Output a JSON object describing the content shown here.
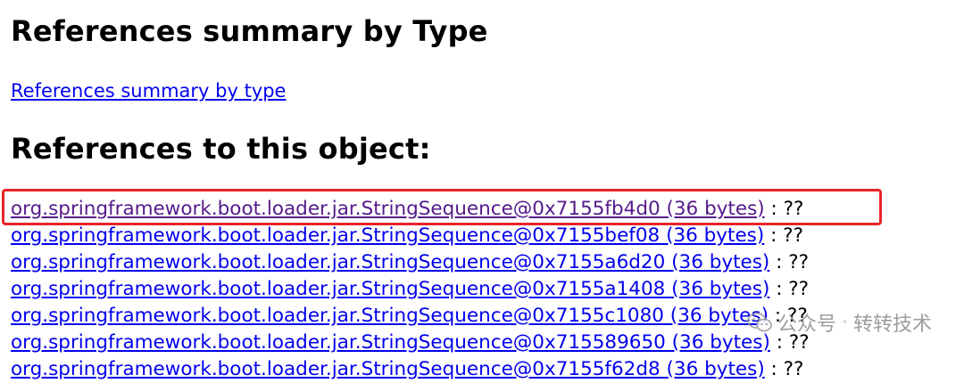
{
  "headings": {
    "summary_by_type": "References summary by Type",
    "references_to_object": "References to this object:"
  },
  "summary_link_label": "References summary by type",
  "references": [
    {
      "link": "org.springframework.boot.loader.jar.StringSequence@0x7155fb4d0 (36 bytes)",
      "suffix": " : ??"
    },
    {
      "link": "org.springframework.boot.loader.jar.StringSequence@0x7155bef08 (36 bytes)",
      "suffix": " : ??"
    },
    {
      "link": "org.springframework.boot.loader.jar.StringSequence@0x7155a6d20 (36 bytes)",
      "suffix": " : ??"
    },
    {
      "link": "org.springframework.boot.loader.jar.StringSequence@0x7155a1408 (36 bytes)",
      "suffix": " : ??"
    },
    {
      "link": "org.springframework.boot.loader.jar.StringSequence@0x7155c1080 (36 bytes)",
      "suffix": " : ??"
    },
    {
      "link": "org.springframework.boot.loader.jar.StringSequence@0x715589650 (36 bytes)",
      "suffix": " : ??"
    },
    {
      "link": "org.springframework.boot.loader.jar.StringSequence@0x7155f62d8 (36 bytes)",
      "suffix": " : ??"
    }
  ],
  "watermark": {
    "label": "公众号",
    "separator": "·",
    "name": "转转技术"
  },
  "colors": {
    "link": "#0000ee",
    "visited_link": "#551a8b",
    "highlight_border": "#e8242b"
  }
}
